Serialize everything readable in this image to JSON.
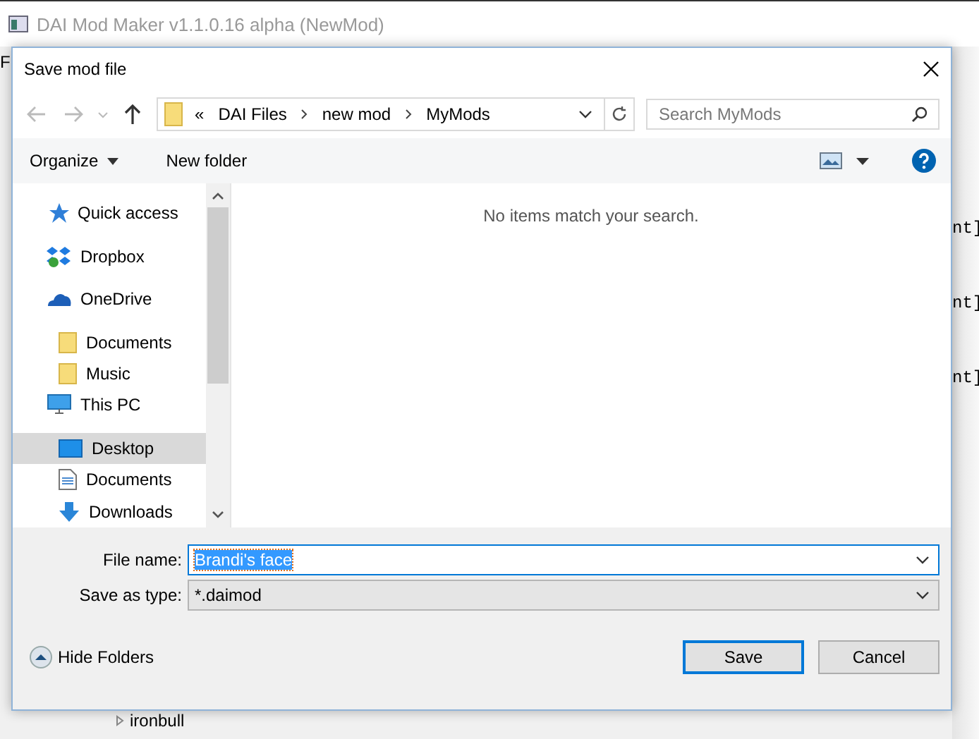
{
  "app": {
    "title": "DAI Mod Maker v1.1.0.16 alpha (NewMod)",
    "menu_item": "F",
    "side_texts": [
      "nt]",
      "nt]",
      "nt]"
    ],
    "tree_item": "ironbull"
  },
  "dialog": {
    "title": "Save mod file",
    "address": {
      "overflow": "«",
      "crumbs": [
        "DAI Files",
        "new mod",
        "MyMods"
      ]
    },
    "search": {
      "placeholder": "Search MyMods"
    },
    "toolbar": {
      "organize": "Organize",
      "new_folder": "New folder"
    },
    "sidebar": {
      "items": [
        {
          "label": "Quick access",
          "kind": "quick",
          "selected": false
        },
        {
          "label": "Dropbox",
          "kind": "dropbox",
          "selected": false
        },
        {
          "label": "OneDrive",
          "kind": "onedrive",
          "selected": false,
          "children": [
            {
              "label": "Documents",
              "kind": "folder",
              "selected": false
            },
            {
              "label": "Music",
              "kind": "folder",
              "selected": false
            }
          ]
        },
        {
          "label": "This PC",
          "kind": "pc",
          "selected": false,
          "children": [
            {
              "label": "Desktop",
              "kind": "desktop",
              "selected": true
            },
            {
              "label": "Documents",
              "kind": "document",
              "selected": false
            },
            {
              "label": "Downloads",
              "kind": "download",
              "selected": false
            }
          ]
        }
      ]
    },
    "empty_message": "No items match your search.",
    "file_name": {
      "label": "File name:",
      "value": "Brandi's face"
    },
    "save_type": {
      "label": "Save as type:",
      "value": "*.daimod"
    },
    "hide_folders": "Hide Folders",
    "buttons": [
      {
        "label": "Save",
        "default": true
      },
      {
        "label": "Cancel",
        "default": false
      }
    ]
  }
}
